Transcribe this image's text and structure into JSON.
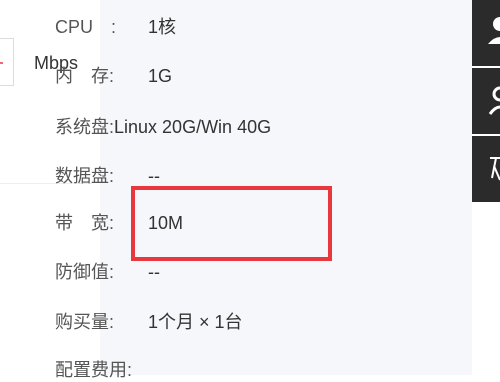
{
  "left": {
    "unit": "Mbps",
    "stepper_icon": "plus-icon"
  },
  "specs": {
    "cpu": {
      "label": "CPU　:",
      "value": "1核"
    },
    "memory": {
      "label": "内　存:",
      "value": "1G"
    },
    "system_disk": {
      "label": "系统盘:",
      "value": "Linux 20G/Win 40G"
    },
    "data_disk": {
      "label": "数据盘:",
      "value": "--"
    },
    "bandwidth": {
      "label": "带　宽:",
      "value": "10M"
    },
    "defense": {
      "label": "防御值:",
      "value": "--"
    },
    "quantity": {
      "label": "购买量:",
      "value": "1个月 × 1台"
    },
    "fee": {
      "label": "配置费用:"
    }
  },
  "colors": {
    "highlight": "#e8383d",
    "panel_bg": "#f5f7fa",
    "toolbar_bg": "#2b2b2b"
  },
  "toolbar": {
    "icons": [
      "user-icon",
      "user-icon",
      "text-icon"
    ]
  }
}
